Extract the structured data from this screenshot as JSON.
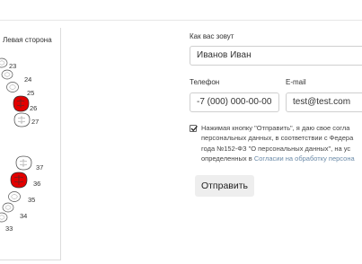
{
  "tooth_chart": {
    "side_label": "Левая сторона",
    "upper_teeth": [
      "23",
      "24",
      "25",
      "26",
      "27"
    ],
    "lower_teeth": [
      "37",
      "36",
      "35",
      "34",
      "33"
    ],
    "selected_teeth": [
      "26",
      "36"
    ],
    "selected_color": "#e30000"
  },
  "form": {
    "name_label": "Как вас зовут",
    "name_value": "Иванов Иван",
    "phone_label": "Телефон",
    "phone_value": "-7 (000) 000-00-00",
    "email_label": "E-mail",
    "email_value": "test@test.com",
    "consent_line1": "Нажимая кнопку \"Отправить\", я даю свое согла",
    "consent_line2": "персональных данных, в соответствии с Федера",
    "consent_line3": "года №152-ФЗ \"О персональных данных\", на ус",
    "consent_line4_text": "определенных в ",
    "consent_link": "Согласии на обработку персона",
    "consent_checked": true,
    "submit_label": "Отправить"
  }
}
